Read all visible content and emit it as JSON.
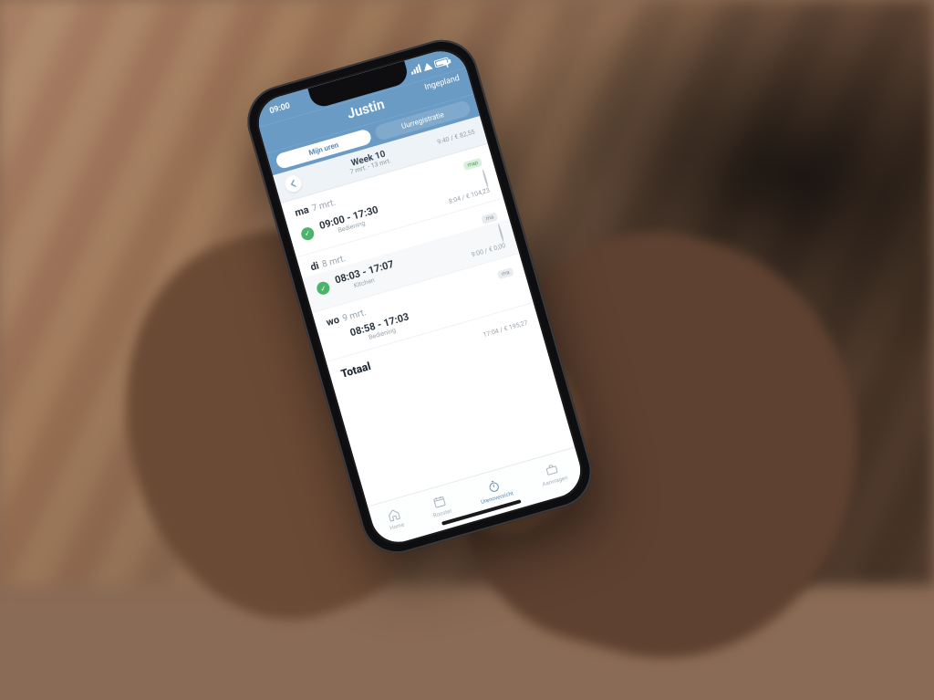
{
  "status": {
    "time": "09:00"
  },
  "header": {
    "title": "Justin",
    "right_label": "Ingepland"
  },
  "segments": {
    "mine": "Mijn uren",
    "unreg": "Uurregistratie"
  },
  "week": {
    "label": "Week 10",
    "range": "7 mrt. - 13 mrt.",
    "summary": "9:40 / € 82,55"
  },
  "days": [
    {
      "dow": "ma",
      "date": "7 mrt.",
      "badge": "map",
      "badge_style": "green",
      "shift": {
        "time": "09:00 - 17:30",
        "location": "Bediening",
        "hours": "8:04 / € 104,23",
        "status": "ok"
      }
    },
    {
      "dow": "di",
      "date": "8 mrt.",
      "badge": "ma",
      "badge_style": "grey",
      "shift": {
        "time": "08:03 - 17:07",
        "location": "Kitchen",
        "hours": "9:00 / € 0,00",
        "status": "ok"
      }
    },
    {
      "dow": "wo",
      "date": "9 mrt.",
      "badge": "ma",
      "badge_style": "grey",
      "shift": {
        "time": "08:58 - 17:03",
        "location": "Bediening",
        "hours": "",
        "status": "none"
      }
    }
  ],
  "totaal": {
    "label": "Totaal",
    "value": "17:04 / € 195,27"
  },
  "tabs": {
    "home": "Home",
    "rooster": "Rooster",
    "uren": "Urenoverzicht",
    "aanvragen": "Aanvragen"
  }
}
